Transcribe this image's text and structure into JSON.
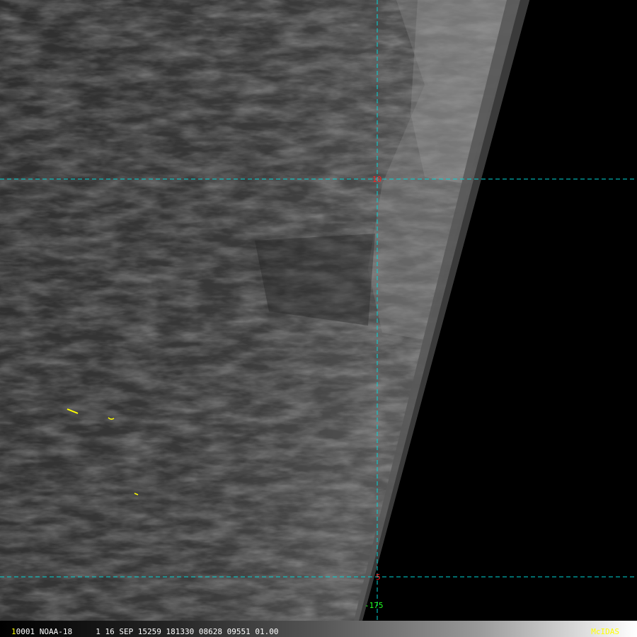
{
  "map": {
    "lat_labels": [
      {
        "id": "lat-10",
        "text": "10",
        "color": "#ff2020"
      },
      {
        "id": "lat-5",
        "text": "5",
        "color": "#ff2020"
      }
    ],
    "lon_labels": [
      {
        "id": "lon-175",
        "text": "-175",
        "color": "#20ff20"
      }
    ],
    "grid_color": "#00d8d8",
    "coast_color": "#ffff00"
  },
  "status_bar": {
    "frame_number": "1",
    "info": "0001 NOAA-18     1 16 SEP 15259 181330 08628 09551 01.00",
    "brand": "McIDAS"
  }
}
